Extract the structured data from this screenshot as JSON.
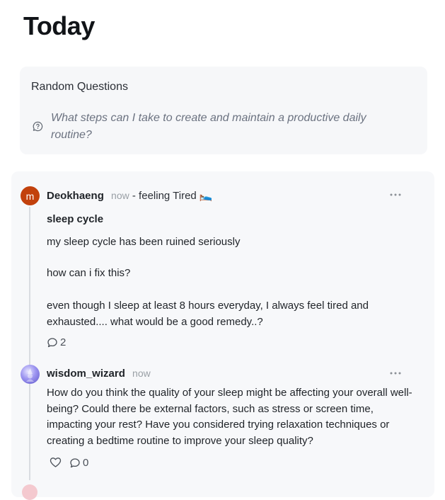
{
  "page": {
    "title": "Today"
  },
  "random_questions": {
    "title": "Random Questions",
    "icon": "question-bubble-icon",
    "question": "What steps can I take to create and maintain a productive daily routine?"
  },
  "post": {
    "avatar_letter": "m",
    "avatar_color": "#c2410c",
    "author": "Deokhaeng",
    "time": "now",
    "feeling": "- feeling Tired 🛌",
    "title": "sleep cycle",
    "paragraphs": [
      "my sleep cycle has been ruined seriously",
      "how can i fix this?",
      "even though I sleep at least 8 hours everyday, I always feel tired and exhausted.... what would be a good remedy..?"
    ],
    "comment_count": "2"
  },
  "reply": {
    "author": "wisdom_wizard",
    "time": "now",
    "body": "How do you think the quality of your sleep might be affecting your overall well-being? Could there be external factors, such as stress or screen time, impacting your rest? Have you considered trying relaxation techniques or creating a bedtime routine to improve your sleep quality?",
    "comment_count": "0"
  },
  "colors": {
    "card_bg": "#f6f7f9",
    "muted": "#9aa0a6",
    "thread_line": "#d9dce1"
  }
}
